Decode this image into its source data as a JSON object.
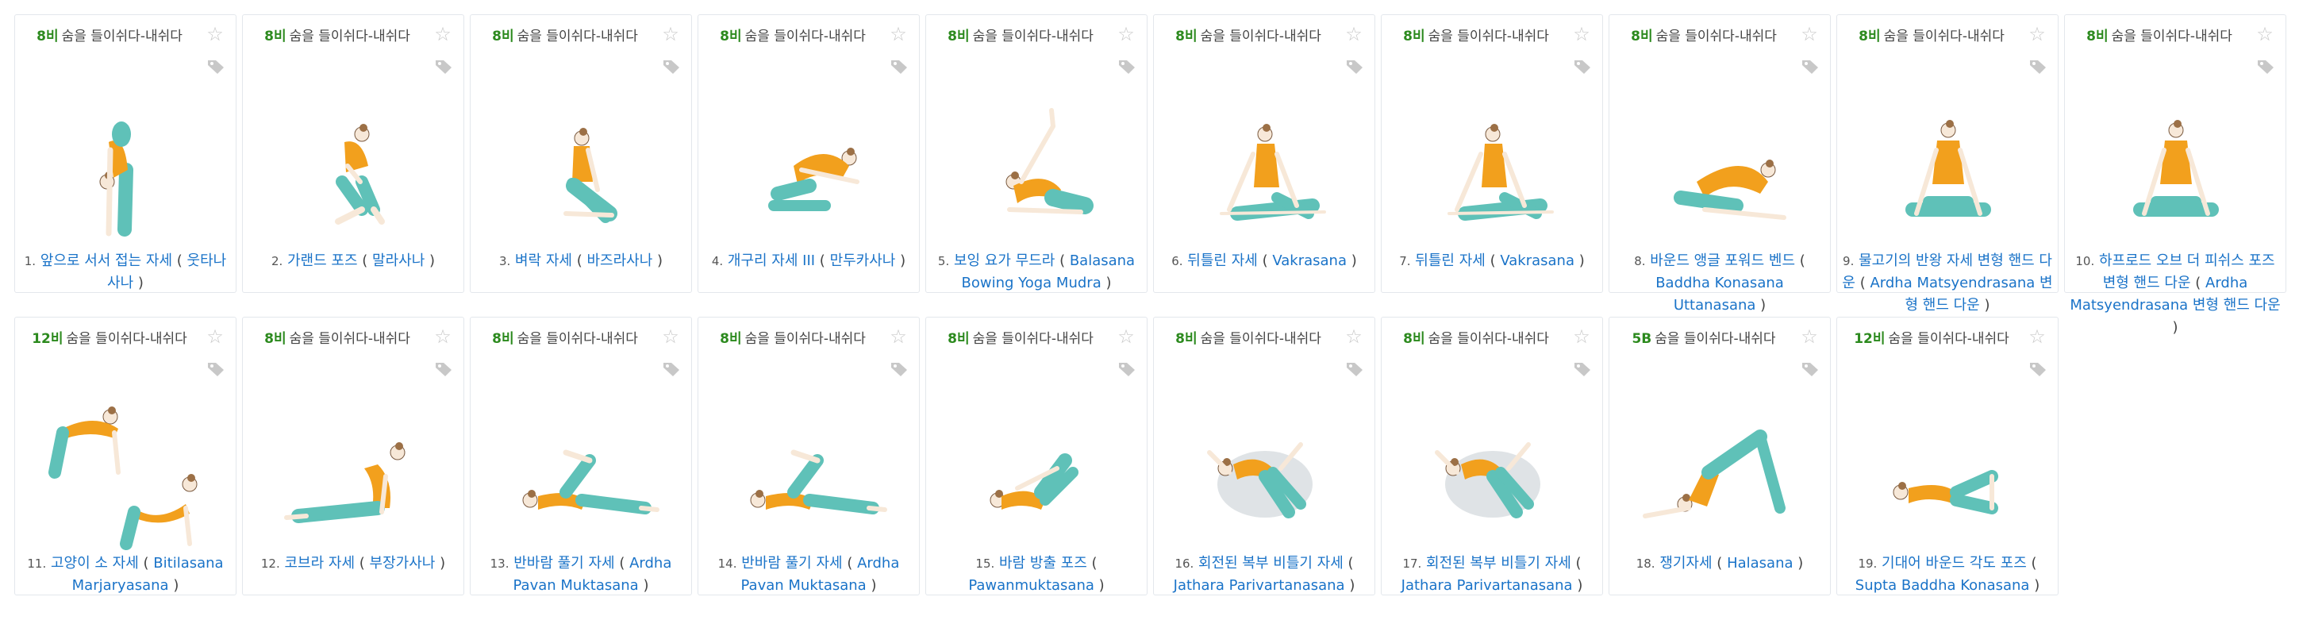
{
  "favorite_icon": "star-icon",
  "tag_icon": "tag-icon",
  "colors": {
    "link": "#1a73c8",
    "breath": "#2c8a1e",
    "top": "#f2a01d",
    "pants": "#5fc1b8",
    "skin": "#f7e8d8",
    "hair": "#9c7046"
  },
  "cards": [
    {
      "breath": "8비",
      "breath_text": "숨을 들이쉬다-내쉬다",
      "number": "1.",
      "title": "앞으로 서서 접는 자세",
      "open": "(",
      "latin": "웃타나사나",
      "close": ")",
      "pose": "standing-fold"
    },
    {
      "breath": "8비",
      "breath_text": "숨을 들이쉬다-내쉬다",
      "number": "2.",
      "title": "가랜드 포즈",
      "open": "(",
      "latin": "말라사나",
      "close": ")",
      "pose": "squat"
    },
    {
      "breath": "8비",
      "breath_text": "숨을 들이쉬다-내쉬다",
      "number": "3.",
      "title": "벼락 자세",
      "open": "(",
      "latin": "바즈라사나",
      "close": ")",
      "pose": "kneel"
    },
    {
      "breath": "8비",
      "breath_text": "숨을 들이쉬다-내쉬다",
      "number": "4.",
      "title": "개구리 자세 III",
      "open": "(",
      "latin": "만두카사나",
      "close": ")",
      "pose": "frog"
    },
    {
      "breath": "8비",
      "breath_text": "숨을 들이쉬다-내쉬다",
      "number": "5.",
      "title": "보잉 요가 무드라",
      "open": "(",
      "latin": "Balasana Bowing Yoga Mudra",
      "close": ")",
      "pose": "child-arm"
    },
    {
      "breath": "8비",
      "breath_text": "숨을 들이쉬다-내쉬다",
      "number": "6.",
      "title": "뒤틀린 자세",
      "open": "(",
      "latin": "Vakrasana",
      "close": ")",
      "pose": "seated-twist"
    },
    {
      "breath": "8비",
      "breath_text": "숨을 들이쉬다-내쉬다",
      "number": "7.",
      "title": "뒤틀린 자세",
      "open": "(",
      "latin": "Vakrasana",
      "close": ")",
      "pose": "seated-twist"
    },
    {
      "breath": "8비",
      "breath_text": "숨을 들이쉬다-내쉬다",
      "number": "8.",
      "title": "바운드 앵글 포워드 벤드",
      "open": "(",
      "latin": "Baddha Konasana Uttanasana",
      "close": ")",
      "pose": "forward-bend"
    },
    {
      "breath": "8비",
      "breath_text": "숨을 들이쉬다-내쉬다",
      "number": "9.",
      "title": "물고기의 반왕 자세 변형 핸드 다운",
      "open": "(",
      "latin": "Ardha Matsyendrasana 변형 핸드 다운",
      "close": ")",
      "pose": "cross-legged"
    },
    {
      "breath": "8비",
      "breath_text": "숨을 들이쉬다-내쉬다",
      "number": "10.",
      "title": "하프로드 오브 더 피쉬스 포즈 변형 핸드 다운",
      "open": "(",
      "latin": "Ardha Matsyendrasana 변형 핸드 다운",
      "close": ")",
      "pose": "cross-legged"
    },
    {
      "breath": "12비",
      "breath_text": "숨을 들이쉬다-내쉬다",
      "number": "11.",
      "title": "고양이 소 자세",
      "open": "(",
      "latin": "Bitilasana Marjaryasana",
      "close": ")",
      "pose": "cat-cow"
    },
    {
      "breath": "8비",
      "breath_text": "숨을 들이쉬다-내쉬다",
      "number": "12.",
      "title": "코브라 자세",
      "open": "(",
      "latin": "부장가사나",
      "close": ")",
      "pose": "cobra"
    },
    {
      "breath": "8비",
      "breath_text": "숨을 들이쉬다-내쉬다",
      "number": "13.",
      "title": "반바람 풀기 자세",
      "open": "(",
      "latin": "Ardha Pavan Muktasana",
      "close": ")",
      "pose": "wind-release"
    },
    {
      "breath": "8비",
      "breath_text": "숨을 들이쉬다-내쉬다",
      "number": "14.",
      "title": "반바람 풀기 자세",
      "open": "(",
      "latin": "Ardha Pavan Muktasana",
      "close": ")",
      "pose": "wind-release"
    },
    {
      "breath": "8비",
      "breath_text": "숨을 들이쉬다-내쉬다",
      "number": "15.",
      "title": "바람 방출 포즈",
      "open": "(",
      "latin": "Pawanmuktasana",
      "close": ")",
      "pose": "knees-chest"
    },
    {
      "breath": "8비",
      "breath_text": "숨을 들이쉬다-내쉬다",
      "number": "16.",
      "title": "회전된 복부 비틀기 자세",
      "open": "(",
      "latin": "Jathara Parivartanasana",
      "close": ")",
      "pose": "supine-twist"
    },
    {
      "breath": "8비",
      "breath_text": "숨을 들이쉬다-내쉬다",
      "number": "17.",
      "title": "회전된 복부 비틀기 자세",
      "open": "(",
      "latin": "Jathara Parivartanasana",
      "close": ")",
      "pose": "supine-twist"
    },
    {
      "breath": "5B",
      "breath_text": "숨을 들이쉬다-내쉬다",
      "number": "18.",
      "title": "쟁기자세",
      "open": "(",
      "latin": "Halasana",
      "close": ")",
      "pose": "plow"
    },
    {
      "breath": "12비",
      "breath_text": "숨을 들이쉬다-내쉬다",
      "number": "19.",
      "title": "기대어 바운드 각도 포즈",
      "open": "(",
      "latin": "Supta Baddha Konasana",
      "close": ")",
      "pose": "reclined-bound"
    }
  ]
}
